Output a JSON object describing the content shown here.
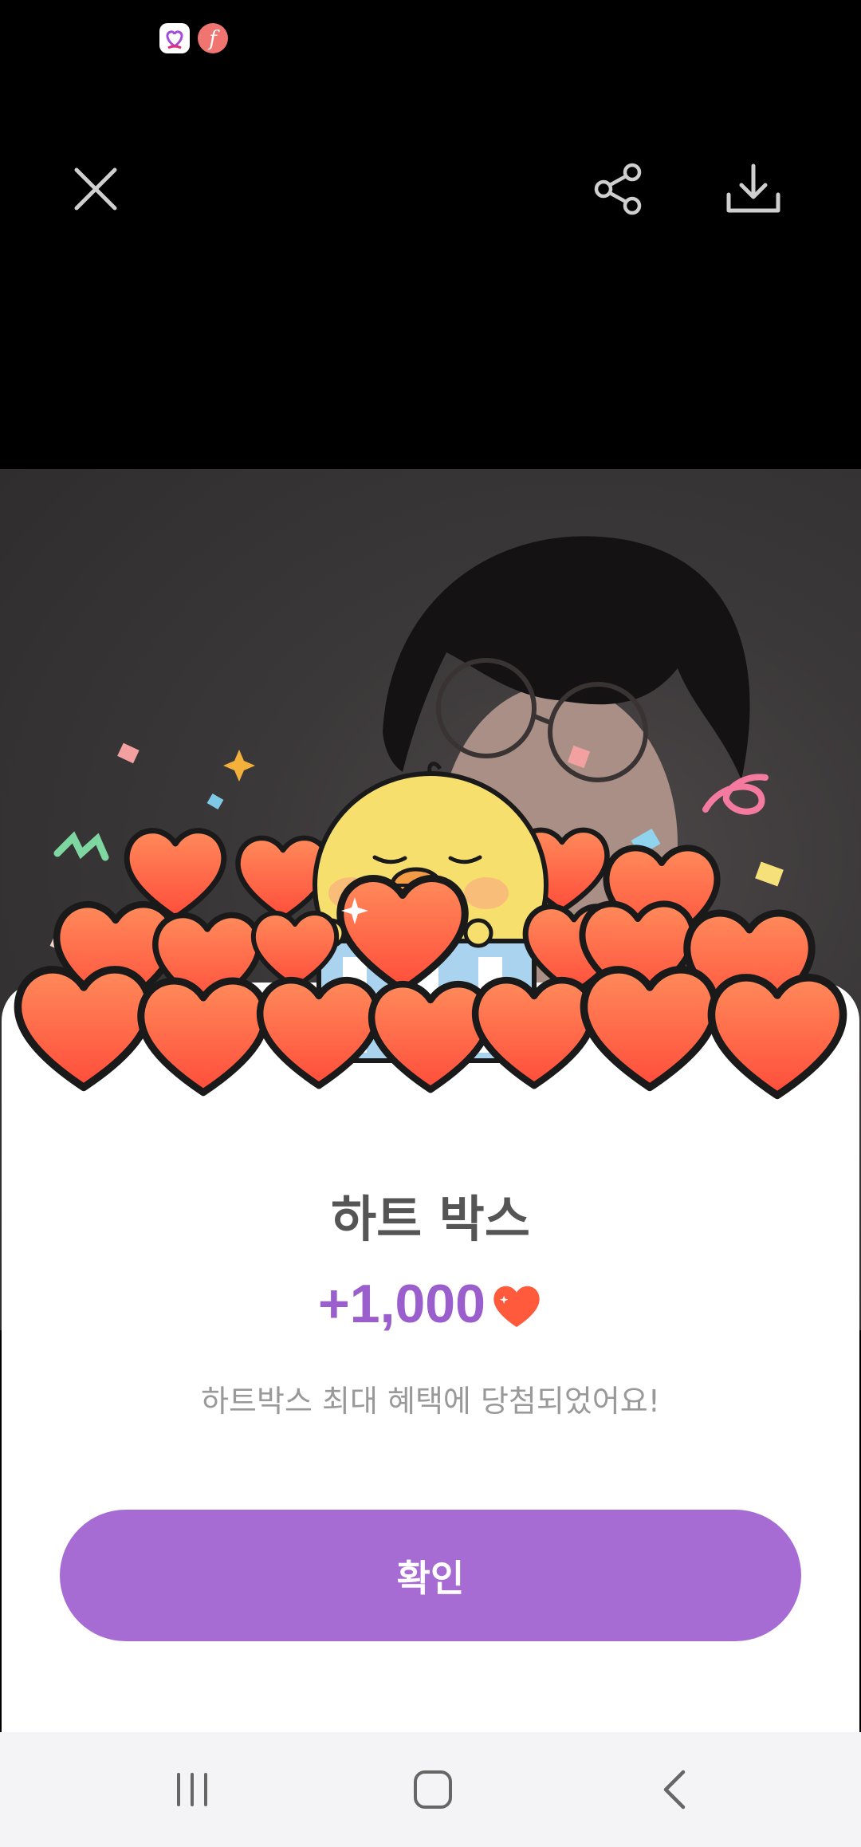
{
  "status_bar": {
    "icons": [
      "heart-app-icon",
      "font-app-icon"
    ]
  },
  "toolbar": {
    "close_icon": "close-icon",
    "share_icon": "share-icon",
    "download_icon": "download-icon"
  },
  "modal": {
    "title": "하트 박스",
    "reward_amount": "+1,000",
    "reward_icon": "heart-icon",
    "message": "하트박스 최대 혜택에 당첨되었어요!",
    "confirm_label": "확인"
  },
  "colors": {
    "accent": "#a76bd4",
    "reward_text": "#9a5fcc",
    "heart": "#ff5a3c"
  },
  "nav_bar": {
    "icons": [
      "recents-icon",
      "home-icon",
      "back-icon"
    ]
  }
}
